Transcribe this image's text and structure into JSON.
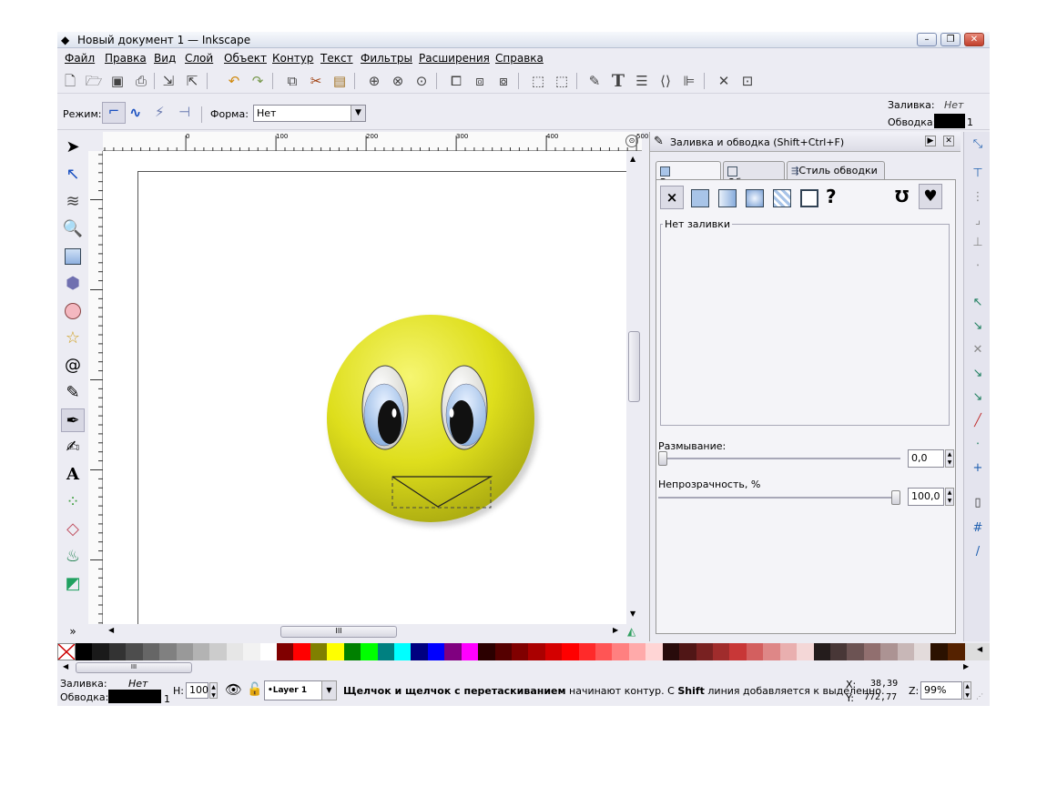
{
  "window": {
    "title": "Новый документ 1 — Inkscape"
  },
  "menu": [
    "Файл",
    "Правка",
    "Вид",
    "Слой",
    "Объект",
    "Контур",
    "Текст",
    "Фильтры",
    "Расширения",
    "Справка"
  ],
  "toolbar": {
    "icons": [
      "new-icon",
      "open-icon",
      "save-icon",
      "print-icon",
      "import-icon",
      "export-icon",
      "undo-icon",
      "redo-icon",
      "copy-icon",
      "cut-icon",
      "paste-icon",
      "zoom-selection-icon",
      "zoom-drawing-icon",
      "zoom-page-icon",
      "duplicate-icon",
      "clone-icon",
      "unlink-icon",
      "group-icon",
      "ungroup-icon",
      "fill-stroke-icon",
      "text-icon",
      "layers-icon",
      "xml-editor-icon",
      "align-icon",
      "preferences-icon",
      "document-properties-icon"
    ]
  },
  "ctrl": {
    "mode_label": "Режим:",
    "shape_label": "Форма:",
    "shape_value": "Нет"
  },
  "style_indicator": {
    "fill_label": "Заливка:",
    "fill_value": "Нет",
    "stroke_label": "Обводка:",
    "stroke_width": "1"
  },
  "ruler": {
    "labels": [
      "0",
      "100",
      "200",
      "300",
      "400",
      "500"
    ]
  },
  "canvas": {
    "face_color": "#dede1c"
  },
  "panel": {
    "title": "Заливка и обводка (Shift+Ctrl+F)",
    "tabs": [
      "Заливка",
      "Обводка",
      "Стиль обводки"
    ],
    "no_fill_label": "Нет заливки",
    "blur_label": "Размывание:",
    "blur_value": "0,0",
    "opacity_label": "Непрозрачность, %",
    "opacity_value": "100,0",
    "opacity_fraction": 1.0,
    "blur_fraction": 0.0
  },
  "palette": {
    "colors": [
      "#000000",
      "#1a1a1a",
      "#333333",
      "#4d4d4d",
      "#666666",
      "#808080",
      "#999999",
      "#b3b3b3",
      "#cccccc",
      "#e6e6e6",
      "#f2f2f2",
      "#ffffff",
      "#800000",
      "#ff0000",
      "#808000",
      "#ffff00",
      "#008000",
      "#00ff00",
      "#008080",
      "#00ffff",
      "#000080",
      "#0000ff",
      "#800080",
      "#ff00ff",
      "#2b0000",
      "#550000",
      "#800000",
      "#aa0000",
      "#d40000",
      "#ff0000",
      "#ff2a2a",
      "#ff5555",
      "#ff8080",
      "#ffaaaa",
      "#ffd5d5",
      "#280b0b",
      "#501616",
      "#782121",
      "#a02c2c",
      "#c83737",
      "#d35f5f",
      "#de8787",
      "#e9afaf",
      "#f4d7d7",
      "#241c1c",
      "#483737",
      "#6c5353",
      "#916f6f",
      "#ac9393",
      "#c8b7b7",
      "#e3dbdb",
      "#2b1100",
      "#552200",
      "#803300",
      "#aa4400",
      "#d45500",
      "#ff6600"
    ]
  },
  "status": {
    "fill_label": "Заливка:",
    "fill_value": "Нет",
    "stroke_label": "Обводка:",
    "stroke_width": "1",
    "h_label": "Н:",
    "h_value": "100",
    "layer": "•Layer 1",
    "message_bold1": "Щелчок и щелчок с перетаскиванием",
    "message_text1": " начинают контур. С ",
    "message_bold2": "Shift",
    "message_text2": " линия добавляется к выделенно.",
    "x_label": "X:",
    "x_value": "38,39",
    "y_label": "Y:",
    "y_value": "772,77",
    "z_label": "Z:",
    "zoom": "99%"
  }
}
